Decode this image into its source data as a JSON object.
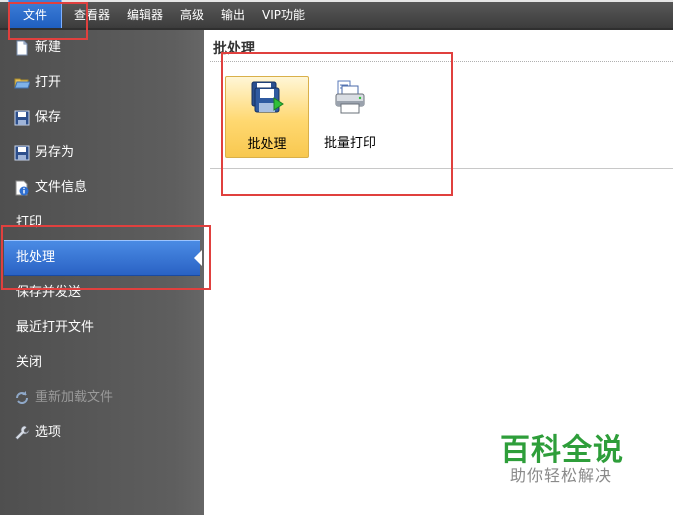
{
  "menubar": {
    "items": [
      "文件",
      "查看器",
      "编辑器",
      "高级",
      "输出",
      "VIP功能"
    ],
    "active_index": 0
  },
  "sidebar": {
    "items": [
      {
        "label": "新建",
        "icon": "new-file-icon"
      },
      {
        "label": "打开",
        "icon": "open-folder-icon"
      },
      {
        "label": "保存",
        "icon": "save-icon"
      },
      {
        "label": "另存为",
        "icon": "save-as-icon"
      },
      {
        "label": "文件信息",
        "icon": "file-info-icon"
      },
      {
        "label": "打印",
        "icon": ""
      },
      {
        "label": "批处理",
        "icon": "",
        "selected": true
      },
      {
        "label": "保存并发送",
        "icon": ""
      },
      {
        "label": "最近打开文件",
        "icon": ""
      },
      {
        "label": "关闭",
        "icon": ""
      },
      {
        "label": "重新加载文件",
        "icon": "reload-icon",
        "disabled": true
      },
      {
        "label": "选项",
        "icon": "wrench-icon"
      }
    ]
  },
  "main": {
    "section_title": "批处理",
    "buttons": [
      {
        "label": "批处理",
        "icon": "batch-process-icon",
        "highlighted": true
      },
      {
        "label": "批量打印",
        "icon": "batch-print-icon"
      }
    ]
  },
  "watermark": {
    "title": "百科全说",
    "subtitle": "助你轻松解决"
  },
  "colors": {
    "sidebar_bg": "#5a5a5a",
    "selection_blue": "#2a62c4",
    "highlight_gold": "#ffd870",
    "annotation_red": "#e0403e",
    "watermark_green": "#2e9e3a"
  }
}
